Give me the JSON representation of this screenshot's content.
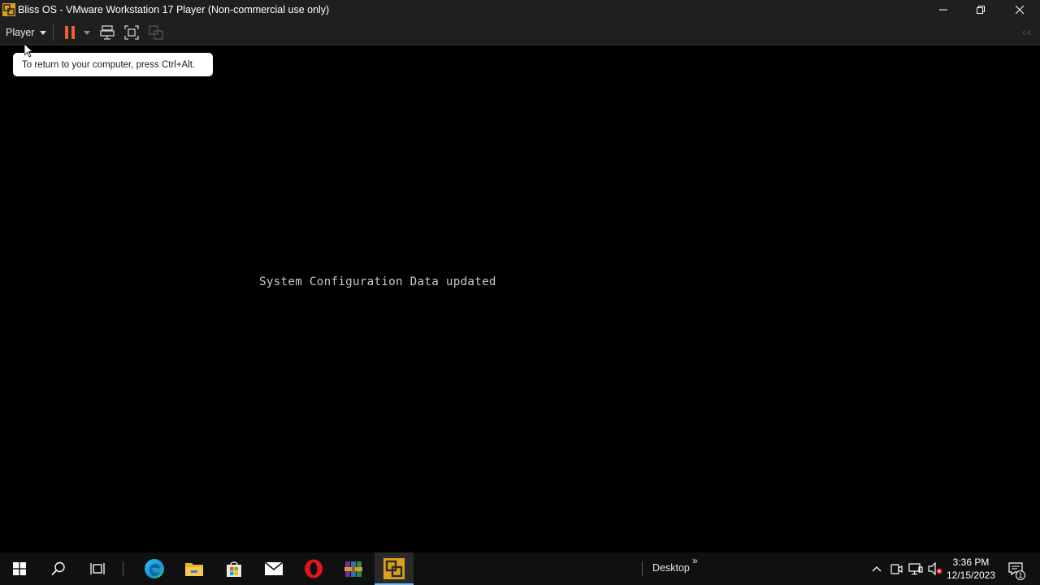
{
  "window": {
    "title": "Bliss OS - VMware Workstation 17 Player (Non-commercial use only)",
    "app_icon": "vmware-icon",
    "controls": [
      "minimize-icon",
      "restore-icon",
      "close-icon"
    ]
  },
  "toolbar": {
    "player_menu_label": "Player",
    "buttons": [
      "pause-icon",
      "dropdown-arrow-icon",
      "send-ctrl-alt-del-icon",
      "full-screen-icon",
      "unity-icon"
    ],
    "collapse_icon": "collapse-toolbar-icon",
    "accent_color": "#e8632a"
  },
  "tooltip": {
    "text": "To return to your computer, press Ctrl+Alt."
  },
  "vm_screen": {
    "message": "System Configuration Data updated"
  },
  "taskbar": {
    "items": [
      "windows-start-icon",
      "search-icon",
      "task-view-icon",
      "edge-icon",
      "file-explorer-icon",
      "microsoft-store-icon",
      "mail-icon",
      "opera-icon",
      "winrar-icon",
      "vmware-icon"
    ],
    "active_item": "vmware-icon",
    "desktop_label": "Desktop",
    "desktop_chevron": "»",
    "tray_icons": [
      "show-hidden-icons-chevron-icon",
      "meet-now-icon",
      "network-icon",
      "volume-muted-icon"
    ],
    "clock": {
      "time": "3:36 PM",
      "date": "12/15/2023"
    },
    "notification_icon": "action-center-icon",
    "notification_count": "1"
  }
}
